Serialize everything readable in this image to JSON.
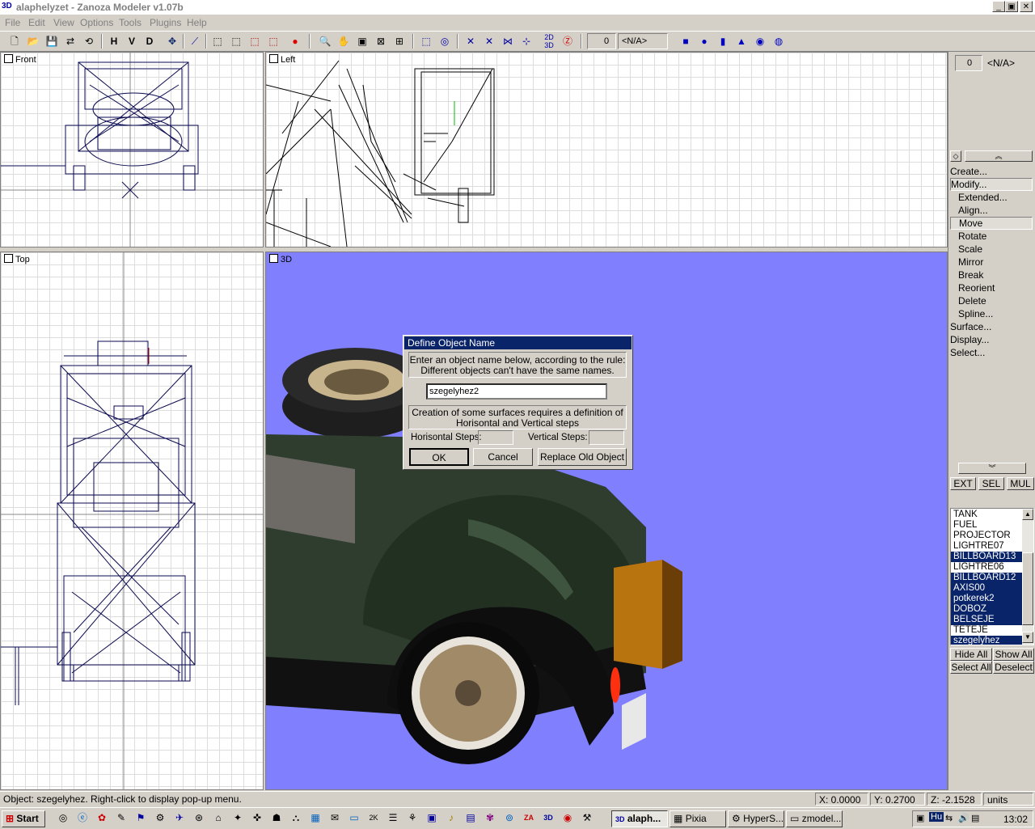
{
  "window": {
    "title": "alaphelyzet - Zanoza Modeler v1.07b",
    "app_icon": "3D",
    "controls": [
      "_",
      "▣",
      "✕"
    ]
  },
  "menu": [
    {
      "label": "File"
    },
    {
      "label": "Edit"
    },
    {
      "label": "View"
    },
    {
      "label": "Options"
    },
    {
      "label": "Tools"
    },
    {
      "label": "Plugins"
    },
    {
      "label": "Help"
    }
  ],
  "toolbar": {
    "text_buttons": [
      "H",
      "V",
      "D"
    ],
    "spinner_value": "0",
    "na_combo": "<N/A>",
    "icons": [
      "new-icon",
      "open-icon",
      "save-icon",
      "export-icon",
      "import-icon",
      "render-icon",
      "select-box-icon",
      "cube-wire-icon",
      "zoom-icon",
      "pan-icon",
      "sphere-icon"
    ]
  },
  "viewports": {
    "front": "Front",
    "left": "Left",
    "top": "Top",
    "three_d": "3D"
  },
  "right_panel": {
    "spinner_value": "0",
    "na_label": "<N/A>",
    "menu": [
      {
        "label": "Create...",
        "sub": false,
        "pressed": false
      },
      {
        "label": "Modify...",
        "sub": false,
        "pressed": true
      },
      {
        "label": "Extended...",
        "sub": true,
        "pressed": false
      },
      {
        "label": "Align...",
        "sub": true,
        "pressed": false
      },
      {
        "label": "Move",
        "sub": true,
        "pressed": true
      },
      {
        "label": "Rotate",
        "sub": true,
        "pressed": false
      },
      {
        "label": "Scale",
        "sub": true,
        "pressed": false
      },
      {
        "label": "Mirror",
        "sub": true,
        "pressed": false
      },
      {
        "label": "Break",
        "sub": true,
        "pressed": false
      },
      {
        "label": "Reorient",
        "sub": true,
        "pressed": false
      },
      {
        "label": "Delete",
        "sub": true,
        "pressed": false
      },
      {
        "label": "Spline...",
        "sub": true,
        "pressed": false
      },
      {
        "label": "Surface...",
        "sub": false,
        "pressed": false
      },
      {
        "label": "Display...",
        "sub": false,
        "pressed": false
      },
      {
        "label": "Select...",
        "sub": false,
        "pressed": false
      }
    ],
    "mode_buttons": [
      "EXT",
      "SEL",
      "MUL"
    ],
    "objects": [
      {
        "name": "TANK",
        "selected": false
      },
      {
        "name": "FUEL",
        "selected": false
      },
      {
        "name": "PROJECTOR",
        "selected": false
      },
      {
        "name": "LIGHTRE07",
        "selected": false
      },
      {
        "name": "BILLBOARD13",
        "selected": true
      },
      {
        "name": "LIGHTRE06",
        "selected": false
      },
      {
        "name": "BILLBOARD12",
        "selected": true
      },
      {
        "name": "AXIS00",
        "selected": true
      },
      {
        "name": "potkerek2",
        "selected": true
      },
      {
        "name": "DOBOZ",
        "selected": true
      },
      {
        "name": "BELSEJE",
        "selected": true
      },
      {
        "name": "TETEJE",
        "selected": false
      },
      {
        "name": "szegelyhez",
        "selected": true
      }
    ],
    "list_buttons": [
      "Hide All",
      "Show All",
      "Select All",
      "Deselect"
    ]
  },
  "dialog": {
    "title": "Define Object Name",
    "rule_text_1": "Enter an object name below, according to the rule:",
    "rule_text_2": "Different objects can't have the same names.",
    "name_value": "szegelyhez2",
    "surface_text_1": "Creation of some surfaces requires a definition of",
    "surface_text_2": "Horisontal and Vertical steps",
    "h_steps_label": "Horisontal Steps:",
    "v_steps_label": "Vertical Steps:",
    "h_steps_value": "",
    "v_steps_value": "",
    "ok": "OK",
    "cancel": "Cancel",
    "replace": "Replace Old Object"
  },
  "status": {
    "message": "Object: szegelyhez. Right-click to display pop-up menu.",
    "x": "X: 0.0000",
    "y": "Y: 0.2700",
    "z": "Z: -2.1528",
    "units": "units"
  },
  "taskbar": {
    "start": "Start",
    "tasks": [
      {
        "label": "alaph...",
        "active": true
      },
      {
        "label": "Pixia",
        "active": false
      },
      {
        "label": "HyperS...",
        "active": false
      },
      {
        "label": "zmodel...",
        "active": false
      }
    ],
    "tray_lang": "Hu",
    "clock": "13:02"
  },
  "colors": {
    "viewport_3d_bg": "#8080ff",
    "selection": "#0a246a",
    "wireframe": "#0a0a50",
    "car_body": "#2e3d2e"
  }
}
